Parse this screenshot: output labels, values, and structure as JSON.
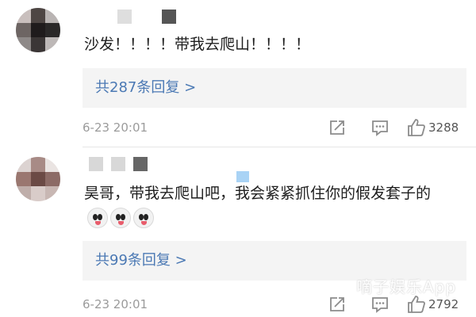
{
  "comments": [
    {
      "avatar_colors": [
        "#c9bfbd",
        "#4e4644",
        "#b9b4b3",
        "#6d6563",
        "#1f1b1c",
        "#2a2828",
        "#8e8988",
        "#3b3636",
        "#bdb8b7"
      ],
      "name_colors": [
        "#dedede",
        "#ffffff",
        "#555555"
      ],
      "text": "沙发！！！！带我去爬山！！！！",
      "emoji": [],
      "replies_label": "共287条回复 >",
      "timestamp": "6-23 20:01",
      "likes": "3288"
    },
    {
      "avatar_colors": [
        "#dcd3d1",
        "#a88b86",
        "#eae4e2",
        "#9a7770",
        "#6b4a45",
        "#8c6b66",
        "#bfaeaa",
        "#d9ccc9",
        "#c8b7b3"
      ],
      "name_colors": [
        "#d8d8d8",
        "#d8d8d8",
        "#666666"
      ],
      "name_accent": "#a9d3f5",
      "text": "昊哥，带我去爬山吧，我会紧紧抓住你的假发套子的",
      "emoji": [
        "face-emoji",
        "face-emoji",
        "face-emoji"
      ],
      "replies_label": "共99条回复 >",
      "timestamp": "6-23 20:01",
      "likes": "2792"
    }
  ],
  "watermark": "嘀子娱乐App",
  "colors": {
    "link": "#4b79b4",
    "meta": "#9b9b9b",
    "icon": "#8c8c8c"
  }
}
